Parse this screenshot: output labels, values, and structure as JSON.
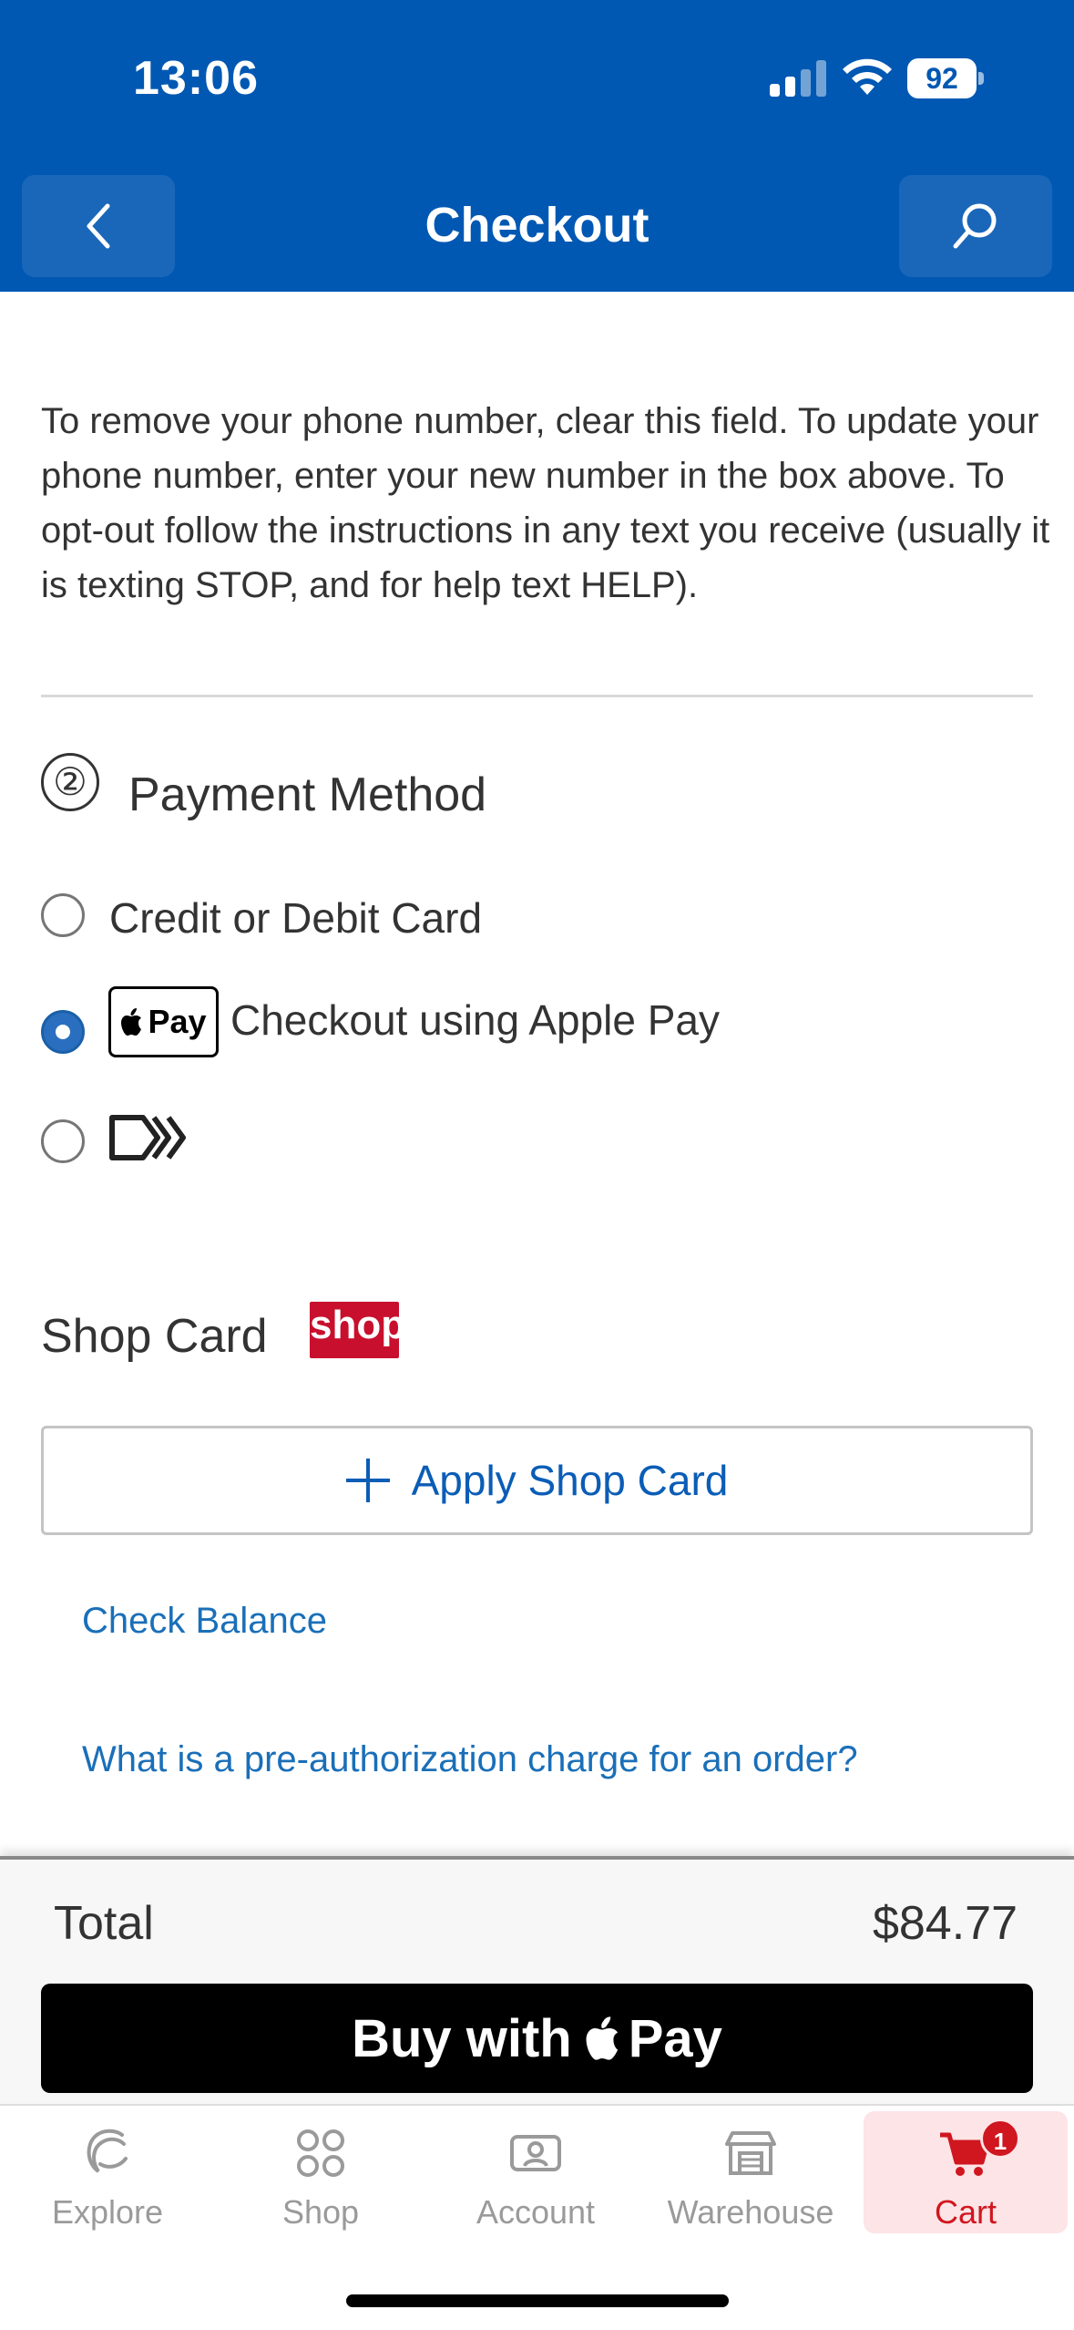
{
  "status_bar": {
    "time": "13:06",
    "battery": "92"
  },
  "header": {
    "title": "Checkout",
    "back_icon": "chevron-left-icon",
    "search_icon": "search-icon"
  },
  "phone_notice": "To remove your phone number, clear this field. To update your phone number, enter your new number in the box above. To opt-out follow the instructions in any text you receive (usually it is texting STOP, and for help text HELP).",
  "payment": {
    "step_number": "②",
    "title": "Payment Method",
    "options": [
      {
        "label": "Credit or Debit Card",
        "selected": false
      },
      {
        "label": "Checkout using Apple Pay",
        "badge": "Pay",
        "selected": true
      },
      {
        "label": "",
        "badge_icon": "link-pay-icon",
        "selected": false
      }
    ]
  },
  "shop_card": {
    "title": "Shop Card",
    "logo_text": "shop",
    "apply_label": "Apply Shop Card",
    "check_balance": "Check Balance",
    "preauth_link": "What is a pre-authorization charge for an order?"
  },
  "total": {
    "label": "Total",
    "amount": "$84.77",
    "buy_prefix": "Buy with",
    "buy_suffix": "Pay"
  },
  "tabs": [
    {
      "label": "Explore",
      "icon": "explore-icon",
      "active": false
    },
    {
      "label": "Shop",
      "icon": "grid-icon",
      "active": false
    },
    {
      "label": "Account",
      "icon": "account-icon",
      "active": false
    },
    {
      "label": "Warehouse",
      "icon": "warehouse-icon",
      "active": false
    },
    {
      "label": "Cart",
      "icon": "cart-icon",
      "active": true,
      "badge": "1"
    }
  ],
  "colors": {
    "brand_blue": "#0058b3",
    "link_blue": "#1a6fb8",
    "cart_red": "#d0161f"
  }
}
